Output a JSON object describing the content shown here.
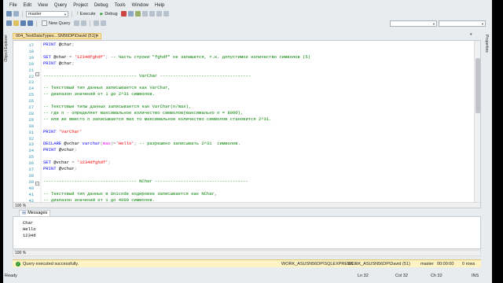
{
  "menu": [
    "File",
    "Edit",
    "View",
    "Query",
    "Project",
    "Debug",
    "Tools",
    "Window",
    "Help"
  ],
  "toolbar": {
    "database": "master",
    "execute_label": "Execute",
    "debug_label": "Debug",
    "new_query_label": "New Query"
  },
  "left_panel_label": "Object Explorer",
  "right_panel_label": "Properties",
  "document_tab": {
    "title": "004_TextDataTypes...SN56DP\\David (51))"
  },
  "editor": {
    "zoom": "100 %",
    "lines": [
      {
        "n": "17",
        "tokens": [
          [
            "kw",
            "PRINT "
          ],
          [
            "vr",
            "@char"
          ],
          [
            "gray",
            ";"
          ]
        ]
      },
      {
        "n": "18",
        "tokens": []
      },
      {
        "n": "19",
        "tokens": [
          [
            "kw",
            "SET "
          ],
          [
            "vr",
            "@char "
          ],
          [
            "gray",
            "= "
          ],
          [
            "str",
            "'1234dfghdf'"
          ],
          [
            "gray",
            "; "
          ],
          [
            "cm",
            "-- Часть строки \"fghdf\" не запишется, т.к. допустимое количество символов (5)"
          ]
        ]
      },
      {
        "n": "20",
        "tokens": [
          [
            "kw",
            "PRINT "
          ],
          [
            "vr",
            "@char"
          ],
          [
            "gray",
            ";"
          ]
        ]
      },
      {
        "n": "21",
        "tokens": []
      },
      {
        "n": "22",
        "tokens": [
          [
            "cm",
            "------------------------------------ VarChar -----------------------------------"
          ]
        ]
      },
      {
        "n": "23",
        "tokens": []
      },
      {
        "n": "24",
        "tokens": [
          [
            "cm",
            "-- Текстовый тип данных записывается как VarChar,"
          ]
        ]
      },
      {
        "n": "25",
        "tokens": [
          [
            "cm",
            "-- диапазон значений от 1 до 2^31 символов."
          ]
        ]
      },
      {
        "n": "26",
        "tokens": []
      },
      {
        "n": "27",
        "tokens": [
          [
            "cm",
            "-- Текстовые типы данных записывается как VarChar(n/max),"
          ]
        ]
      },
      {
        "n": "28",
        "tokens": [
          [
            "cm",
            "-- где n - определяет максимальное количество символов(максимально n = 8000),"
          ]
        ]
      },
      {
        "n": "29",
        "tokens": [
          [
            "cm",
            "-- или же вместо n записывается max то максимальное количество символов становится 2^31."
          ]
        ]
      },
      {
        "n": "30",
        "tokens": []
      },
      {
        "n": "31",
        "tokens": [
          [
            "kw",
            "PRINT "
          ],
          [
            "str",
            "'VarChar'"
          ]
        ]
      },
      {
        "n": "32",
        "tokens": []
      },
      {
        "n": "33",
        "tokens": [
          [
            "kw",
            "DECLARE "
          ],
          [
            "vr",
            "@vchar "
          ],
          [
            "kw",
            "varchar"
          ],
          [
            "gray",
            "("
          ],
          [
            "fn",
            "max"
          ],
          [
            "gray",
            ")="
          ],
          [
            "str",
            "'Hello'"
          ],
          [
            "gray",
            "; "
          ],
          [
            "cm",
            "-- разрешено записывать 2^31  символов."
          ]
        ]
      },
      {
        "n": "34",
        "tokens": [
          [
            "kw",
            "PRINT "
          ],
          [
            "vr",
            "@vchar"
          ],
          [
            "gray",
            ";"
          ]
        ]
      },
      {
        "n": "35",
        "tokens": []
      },
      {
        "n": "36",
        "tokens": [
          [
            "kw",
            "SET "
          ],
          [
            "vr",
            "@vchar "
          ],
          [
            "gray",
            "= "
          ],
          [
            "str",
            "'1234dfghdf'"
          ],
          [
            "gray",
            ";"
          ]
        ]
      },
      {
        "n": "37",
        "tokens": [
          [
            "kw",
            "PRINT "
          ],
          [
            "vr",
            "@vchar"
          ],
          [
            "gray",
            ";"
          ]
        ]
      },
      {
        "n": "38",
        "tokens": []
      },
      {
        "n": "39",
        "tokens": [
          [
            "cm",
            "------------------------------------ NChar ------------------------------------"
          ]
        ]
      },
      {
        "n": "40",
        "tokens": []
      },
      {
        "n": "41",
        "tokens": [
          [
            "cm",
            "-- Текстовый тип данных в Unicode кодировке записывается как NChar,"
          ]
        ]
      },
      {
        "n": "42",
        "tokens": [
          [
            "cm",
            "-- диапазон значений от 1 до 4000 символов."
          ]
        ]
      }
    ]
  },
  "results": {
    "tab_label": "Messages",
    "zoom": "100 %",
    "output": [
      "Char",
      "Hello",
      "1234d"
    ]
  },
  "query_status": {
    "message": "Query executed successfully.",
    "server": "WORK_ASUSN56DP\\SQLEXPRESS ...",
    "login": "WORK_ASUSN56DP\\David (51)",
    "database": "master",
    "elapsed": "00:00:00",
    "rows": "0 rows"
  },
  "status": {
    "ready": "Ready",
    "line": "Ln 32",
    "col": "Col 32",
    "ch": "Ch 32",
    "mode": "INS"
  }
}
